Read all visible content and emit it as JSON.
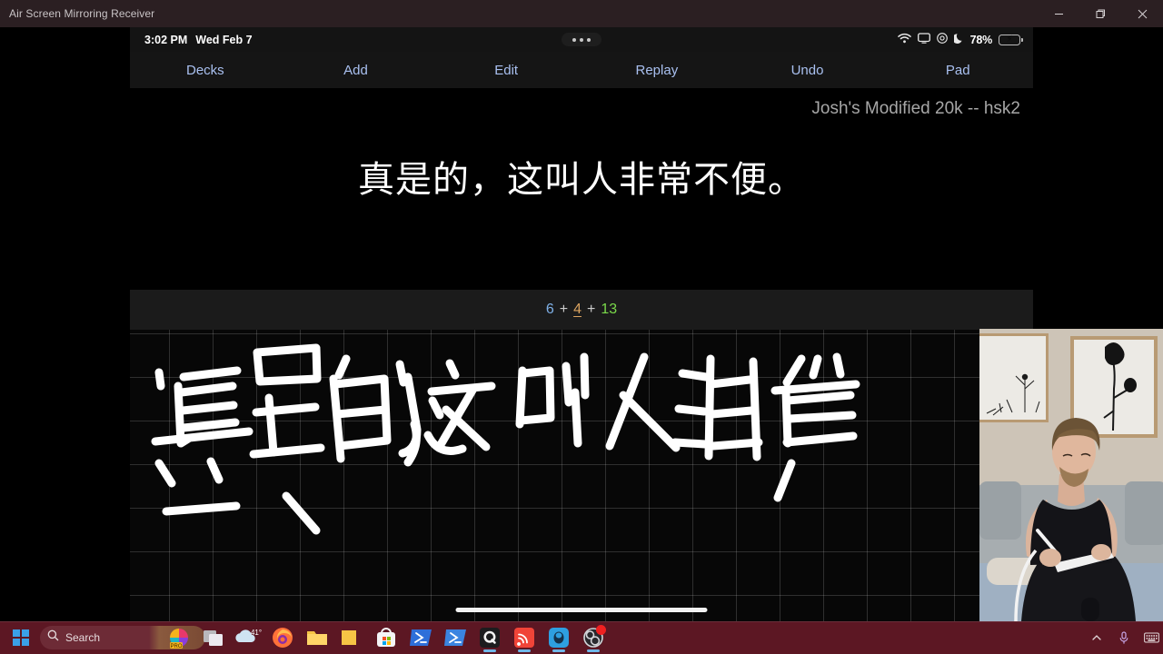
{
  "window": {
    "title": "Air Screen Mirroring Receiver",
    "controls": {
      "minimize": "minimize-button",
      "maximize": "maximize-button",
      "close": "close-button"
    },
    "titlebar_color": "#2b1f22"
  },
  "ios_status_bar": {
    "time": "3:02 PM",
    "date": "Wed Feb 7",
    "center_indicator": "multitasking-dots",
    "icons": [
      "wifi-icon",
      "screen-mirroring-icon",
      "do-not-disturb-icon",
      "moon-icon"
    ],
    "battery_percent": "78%",
    "battery_charging": true,
    "battery_color": "#3ad13a"
  },
  "anki": {
    "toolbar": [
      {
        "label": "Decks",
        "name": "decks"
      },
      {
        "label": "Add",
        "name": "add"
      },
      {
        "label": "Edit",
        "name": "edit"
      },
      {
        "label": "Replay",
        "name": "replay"
      },
      {
        "label": "Undo",
        "name": "undo"
      },
      {
        "label": "Pad",
        "name": "pad"
      }
    ],
    "toolbar_color": "#a9c0f0",
    "deck_name": "Josh's Modified 20k -- hsk2",
    "card_sentence": "真是的，这叫人非常不便。",
    "undo_icon": "undo-circular-arrow-icon",
    "scheduling": {
      "again": "6",
      "good": "4",
      "easy": "13",
      "separator": "+",
      "again_color": "#7fb1e8",
      "good_color": "#d9a25f",
      "easy_color": "#7ad94a"
    },
    "handwriting": {
      "text": "真是的，这叫人非常",
      "ink_color": "#ffffff",
      "grid_color": "rgba(255,255,255,0.16)",
      "background": "#070707"
    },
    "home_indicator": "home-indicator-bar"
  },
  "webcam": {
    "label": "webcam-overlay",
    "description": "person writing on a tablet with stylus on a sofa"
  },
  "taskbar": {
    "background": "#5c1723",
    "start_button": "windows-start-icon",
    "search_placeholder": "Search",
    "weather_temp": "41°",
    "apps": [
      {
        "name": "copilot-office-icon"
      },
      {
        "name": "task-view-icon"
      },
      {
        "name": "weather-widget"
      },
      {
        "name": "firefox-icon"
      },
      {
        "name": "file-explorer-icon"
      },
      {
        "name": "sticky-notes-icon"
      },
      {
        "name": "microsoft-store-icon"
      },
      {
        "name": "powershell-icon"
      },
      {
        "name": "powershell-preview-icon"
      },
      {
        "name": "terminal-icon"
      },
      {
        "name": "airscreen-icon"
      },
      {
        "name": "anki-icon"
      },
      {
        "name": "obs-studio-icon"
      }
    ],
    "tray": [
      "chevron-up-icon",
      "microphone-icon",
      "keyboard-icon"
    ]
  }
}
